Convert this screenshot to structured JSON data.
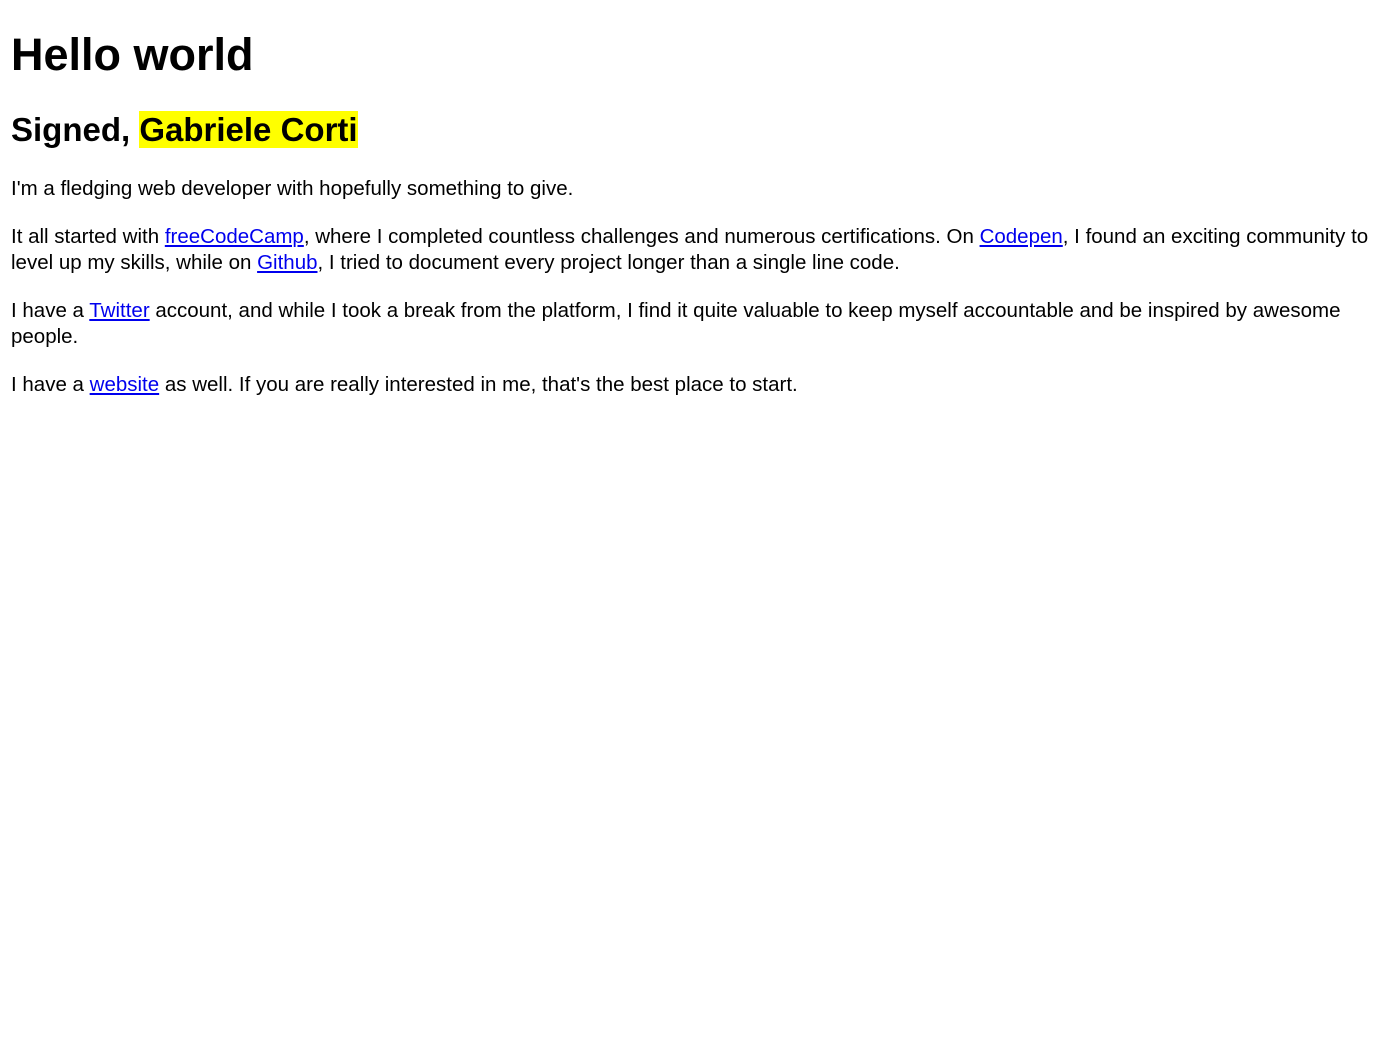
{
  "heading": "Hello world",
  "signature": {
    "prefix": "Signed, ",
    "name": "Gabriele Corti"
  },
  "intro": "I'm a fledging web developer with hopefully something to give.",
  "story": {
    "t1": "It all started with ",
    "link1": "freeCodeCamp",
    "t2": ", where I completed countless challenges and numerous certifications. On ",
    "link2": "Codepen",
    "t3": ", I found an exciting community to level up my skills, while on ",
    "link3": "Github",
    "t4": ", I tried to document every project longer than a single line code."
  },
  "twitter": {
    "t1": "I have a ",
    "link": "Twitter",
    "t2": " account, and while I took a break from the platform, I find it quite valuable to keep myself accountable and be inspired by awesome people."
  },
  "website": {
    "t1": "I have a ",
    "link": "website",
    "t2": " as well. If you are really interested in me, that's the best place to start."
  },
  "colors": {
    "link": "#0000ee",
    "highlight": "#ffff00",
    "text": "#000000",
    "background": "#ffffff"
  }
}
